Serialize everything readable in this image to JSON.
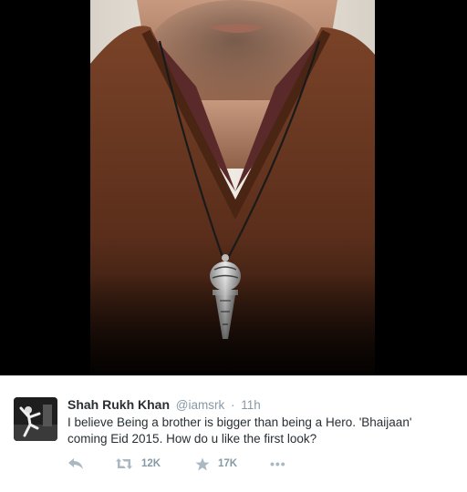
{
  "tweet": {
    "fullname": "Shah Rukh Khan",
    "username": "@iamsrk",
    "separator": "·",
    "time": "11h",
    "text": "I believe Being a brother is bigger than being a Hero. 'Bhaijaan' coming Eid 2015. How do u like the first look?"
  },
  "actions": {
    "retweet_count": "12K",
    "favorite_count": "17K",
    "more_glyph": "•••"
  },
  "icons": {
    "reply": "reply-icon",
    "retweet": "retweet-icon",
    "favorite": "star-icon",
    "more": "more-options-icon"
  },
  "colors": {
    "name": "#292f33",
    "muted": "#8899a6",
    "action_icon": "#aab8c2",
    "sweater": "#6a3a24"
  }
}
